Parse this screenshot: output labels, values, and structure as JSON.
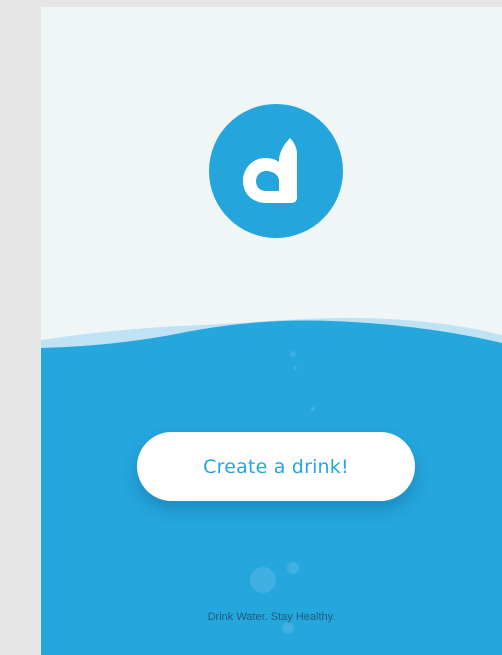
{
  "app": {
    "logo_name": "drop-logo-icon",
    "cta_label": "Create a drink!",
    "tagline": "Drink Water. Stay Healthy."
  },
  "colors": {
    "background_top": "#f0f6f6",
    "water": "#25a6dd",
    "wave_highlight": "#bfe3f4",
    "logo": "#24a6dc",
    "button_text": "#24a6dc",
    "tagline": "#1d5d80",
    "frame": "#e6e6e6"
  }
}
